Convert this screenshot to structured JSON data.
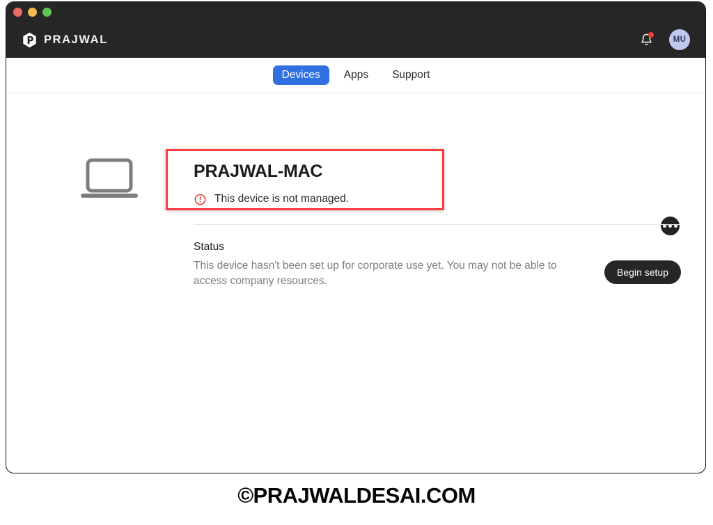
{
  "window": {
    "traffic_lights": [
      {
        "name": "close",
        "color": "#ed6a5f"
      },
      {
        "name": "minimize",
        "color": "#f5bd4f"
      },
      {
        "name": "maximize",
        "color": "#61c554"
      }
    ]
  },
  "header": {
    "brand_name": "PRAJWAL",
    "logo_icon": "hexagon-p-logo-icon",
    "notification_icon": "bell-icon",
    "notification_badge": true,
    "avatar_initials": "MU",
    "avatar_color": "#c3c9ee"
  },
  "nav": {
    "tabs": [
      {
        "label": "Devices",
        "active": true
      },
      {
        "label": "Apps",
        "active": false
      },
      {
        "label": "Support",
        "active": false
      }
    ],
    "active_color": "#2f6fe0"
  },
  "device": {
    "icon": "laptop-icon",
    "name": "PRAJWAL-MAC",
    "warning_icon": "alert-circle-icon",
    "warning_text": "This device is not managed.",
    "warning_color": "#e03030",
    "menu_icon": "kebab-menu-icon",
    "annotation_color": "#fb3b40"
  },
  "status": {
    "label": "Status",
    "description": "This device hasn't been set up for corporate use yet. You may not be able to access company resources.",
    "button_label": "Begin setup"
  },
  "footer": {
    "watermark": "©PRAJWALDESAI.COM"
  }
}
